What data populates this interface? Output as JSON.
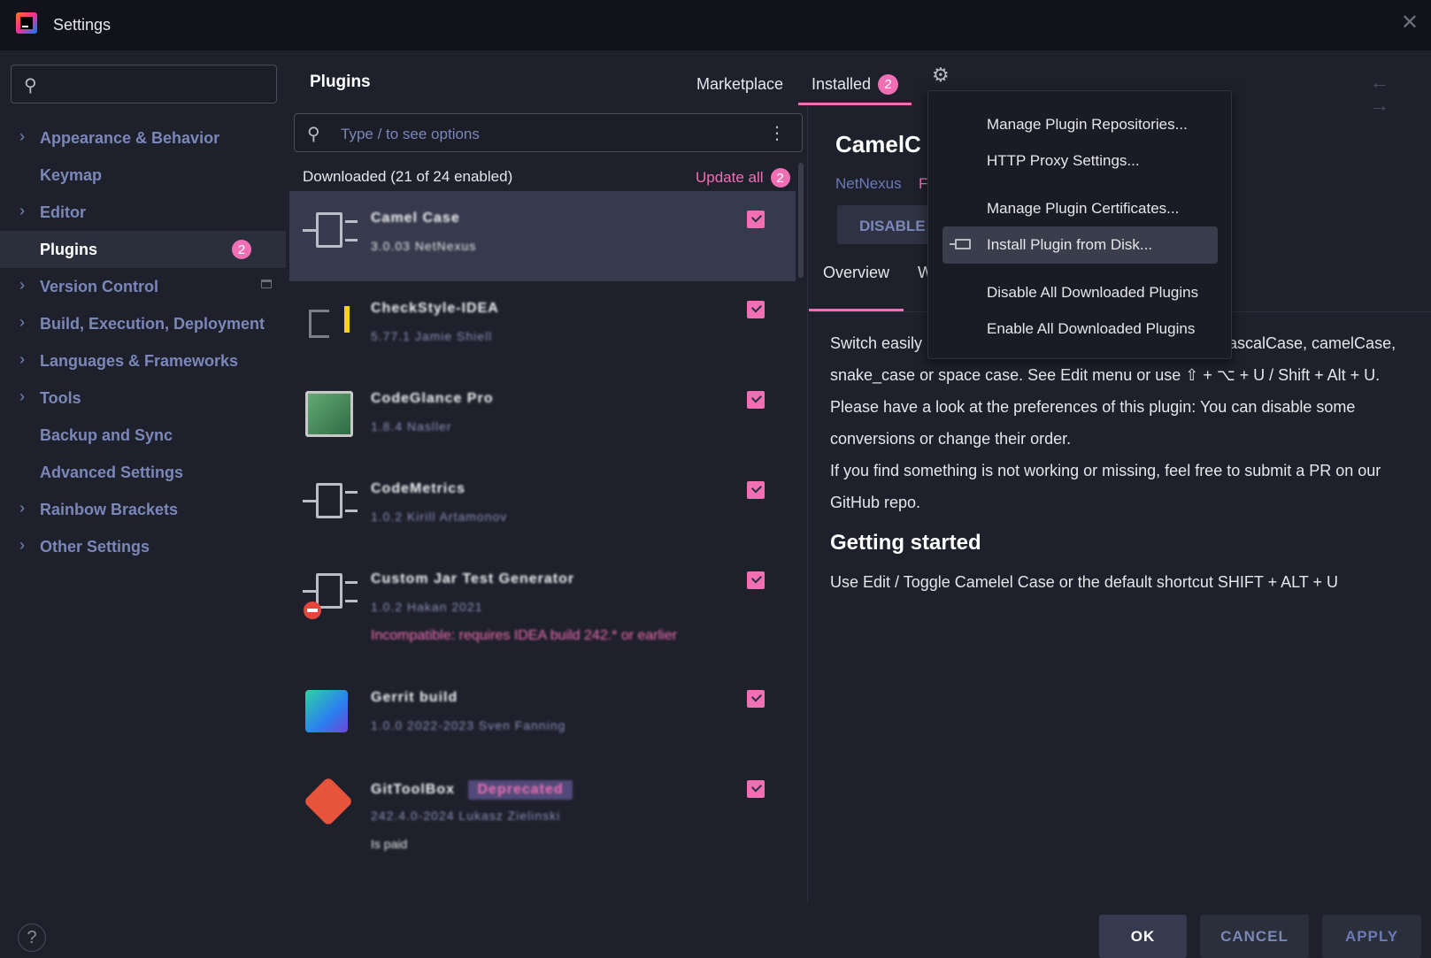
{
  "window": {
    "title": "Settings",
    "close_glyph": "✕"
  },
  "sidebar": {
    "search_icon": "⚲",
    "items": [
      {
        "label": "Appearance & Behavior",
        "expandable": true
      },
      {
        "label": "Keymap",
        "expandable": false
      },
      {
        "label": "Editor",
        "expandable": true
      },
      {
        "label": "Plugins",
        "expandable": false,
        "active": true,
        "badge": "2"
      },
      {
        "label": "Version Control",
        "expandable": true
      },
      {
        "label": "Build, Execution, Deployment",
        "expandable": true
      },
      {
        "label": "Languages & Frameworks",
        "expandable": true
      },
      {
        "label": "Tools",
        "expandable": true
      },
      {
        "label": "Backup and Sync",
        "expandable": false
      },
      {
        "label": "Advanced Settings",
        "expandable": false
      },
      {
        "label": "Rainbow Brackets",
        "expandable": true
      },
      {
        "label": "Other Settings",
        "expandable": true
      }
    ],
    "chevron": "›"
  },
  "plugins": {
    "header": "Plugins",
    "tabs": {
      "marketplace": "Marketplace",
      "installed": "Installed",
      "installed_badge": "2"
    },
    "gear_glyph": "⚙",
    "history_arrows": "← →",
    "search": {
      "placeholder": "Type / to see options",
      "icon": "⚲",
      "kebab": "⋮"
    },
    "downloaded_header": "Downloaded (21 of 24 enabled)",
    "update_all": "Update all",
    "update_badge": "2",
    "list": [
      {
        "name": "Camel Case",
        "sub": "3.0.03 NetNexus",
        "icon": "plug-icon"
      },
      {
        "name": "CheckStyle-IDEA",
        "sub": "5.77.1 Jamie Shiell",
        "icon": "checkstyle-icon"
      },
      {
        "name": "CodeGlance Pro",
        "sub": "1.8.4 Nasller",
        "icon": "codeglance-icon"
      },
      {
        "name": "CodeMetrics",
        "sub": "1.0.2 Kirill Artamonov",
        "icon": "plug-icon"
      },
      {
        "name": "Custom Jar Test Generator",
        "sub": "1.0.2 Hakan 2021",
        "warn": "Incompatible: requires IDEA build 242.* or earlier",
        "icon": "plug-icon"
      },
      {
        "name": "Gerrit build",
        "sub": "1.0.0 2022-2023 Sven Fanning",
        "icon": "rainbow-icon"
      },
      {
        "name": "GitToolBox",
        "deprecated": "Deprecated",
        "sub": "242.4.0-2024 Lukasz Zielinski",
        "note": "Is paid",
        "icon": "git-icon"
      }
    ]
  },
  "detail": {
    "title": "CamelC",
    "vendor": "NetNexus",
    "vendor_link": "F",
    "disable_button": "DISABLE",
    "tabs": {
      "overview": "Overview",
      "w": "W"
    },
    "desc_line1_a": "Switch easily",
    "desc_line1_b": "ascalCase, camelCase,",
    "desc_line2": "snake_case or space case. See Edit menu or use ⇧ + ⌥ + U / Shift + Alt + U.",
    "desc_line3": "Please have a look at the preferences of this plugin: You can disable some",
    "desc_line4": "conversions or change their order.",
    "desc_line5": "If you find something is not working or missing, feel free to submit a PR on our",
    "desc_line6": "GitHub repo.",
    "getting_started": "Getting started",
    "usage": "Use Edit / Toggle Camelel Case or the default shortcut SHIFT + ALT + U"
  },
  "gear_menu": {
    "items": [
      "Manage Plugin Repositories...",
      "HTTP Proxy Settings...",
      "Manage Plugin Certificates...",
      "Install Plugin from Disk...",
      "Disable All Downloaded Plugins",
      "Enable All Downloaded Plugins"
    ]
  },
  "footer": {
    "help": "?",
    "ok": "OK",
    "cancel": "CANCEL",
    "apply": "APPLY"
  },
  "colors": {
    "accent": "#f06fb5",
    "background": "#1e202b",
    "titlebar": "#12131a",
    "nav_text": "#7a87b8"
  }
}
